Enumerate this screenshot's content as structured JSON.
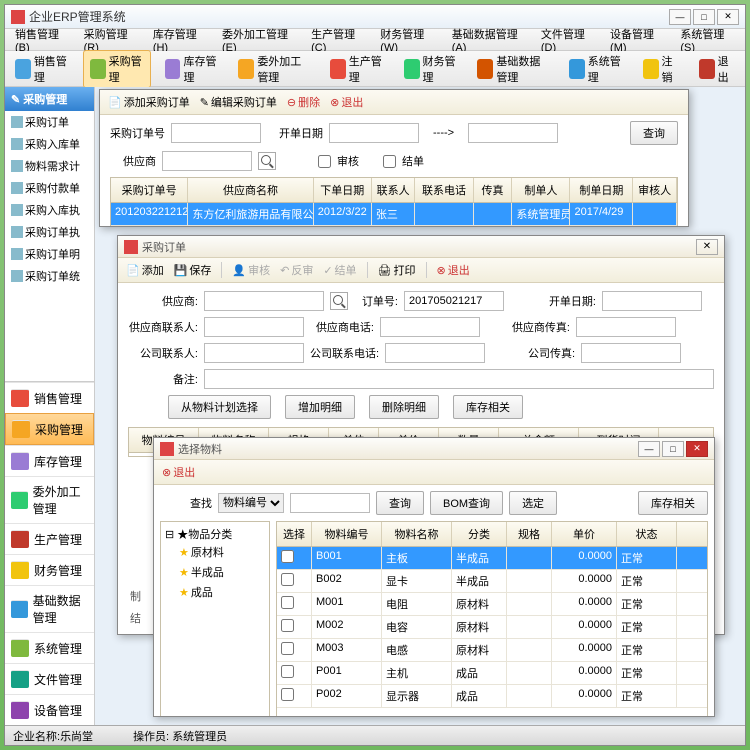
{
  "app_title": "企业ERP管理系统",
  "menubar": [
    "销售管理(B)",
    "采购管理(R)",
    "库存管理(H)",
    "委外加工管理(E)",
    "生产管理(C)",
    "财务管理(W)",
    "基础数据管理(A)",
    "文件管理(D)",
    "设备管理(M)",
    "系统管理(S)"
  ],
  "toolbar": [
    {
      "label": "销售管理",
      "color": "#4aa3df"
    },
    {
      "label": "采购管理",
      "color": "#7fb93e",
      "active": true
    },
    {
      "label": "库存管理",
      "color": "#9a7cd4"
    },
    {
      "label": "委外加工管理",
      "color": "#f5a623"
    },
    {
      "label": "生产管理",
      "color": "#e74c3c"
    },
    {
      "label": "财务管理",
      "color": "#2ecc71"
    },
    {
      "label": "基础数据管理",
      "color": "#d35400"
    },
    {
      "label": "系统管理",
      "color": "#3498db"
    },
    {
      "label": "注销",
      "color": "#f1c40f"
    },
    {
      "label": "退出",
      "color": "#c0392b"
    }
  ],
  "sidebar": {
    "header": "采购管理",
    "items": [
      "采购订单",
      "采购入库单",
      "物料需求计",
      "采购付款单",
      "采购入库执",
      "采购订单执",
      "采购订单明",
      "采购订单统"
    ],
    "bottom": [
      {
        "label": "销售管理",
        "color": "#e74c3c"
      },
      {
        "label": "采购管理",
        "color": "#f5a623",
        "active": true
      },
      {
        "label": "库存管理",
        "color": "#9a7cd4"
      },
      {
        "label": "委外加工管理",
        "color": "#2ecc71"
      },
      {
        "label": "生产管理",
        "color": "#c0392b"
      },
      {
        "label": "财务管理",
        "color": "#f1c40f"
      },
      {
        "label": "基础数据管理",
        "color": "#3498db"
      },
      {
        "label": "系统管理",
        "color": "#7fb93e"
      },
      {
        "label": "文件管理",
        "color": "#16a085"
      },
      {
        "label": "设备管理",
        "color": "#8e44ad"
      }
    ]
  },
  "statusbar": {
    "company_label": "企业名称:",
    "company": "乐尚堂",
    "operator_label": "操作员:",
    "operator": "系统管理员"
  },
  "dialog1": {
    "toolbar": {
      "add": "添加采购订单",
      "edit": "编辑采购订单",
      "del": "删除",
      "exit": "退出"
    },
    "labels": {
      "order_no": "采购订单号",
      "date": "开单日期",
      "arrow": "---->",
      "query": "查询",
      "supplier": "供应商",
      "audit": "审核",
      "close": "结单"
    },
    "grid_headers": [
      "采购订单号",
      "供应商名称",
      "下单日期",
      "联系人",
      "联系电话",
      "传真",
      "制单人",
      "制单日期",
      "审核人"
    ],
    "grid_row": [
      "201203221212",
      "东方亿利旅游用品有限公司",
      "2012/3/22",
      "张三",
      "",
      "",
      "系统管理员",
      "2017/4/29",
      ""
    ]
  },
  "dialog2": {
    "title": "采购订单",
    "toolbar": {
      "add": "添加",
      "save": "保存",
      "audit": "审核",
      "unaudit": "反审",
      "close": "结单",
      "print": "打印",
      "exit": "退出"
    },
    "labels": {
      "supplier": "供应商:",
      "order_no": "订单号:",
      "order_no_val": "201705021217",
      "date": "开单日期:",
      "supplier_contact": "供应商联系人:",
      "supplier_phone": "供应商电话:",
      "supplier_fax": "供应商传真:",
      "company_contact": "公司联系人:",
      "company_phone": "公司联系电话:",
      "company_fax": "公司传真:",
      "remark": "备注:"
    },
    "buttons": {
      "from_plan": "从物料计划选择",
      "add_detail": "增加明细",
      "del_detail": "删除明细",
      "stock": "库存相关"
    },
    "grid_headers": [
      "物料编号",
      "物料名称",
      "规格",
      "单位",
      "单价",
      "数量",
      "总金额",
      "到货时间"
    ],
    "bottom": {
      "maker": "制",
      "closer": "结"
    }
  },
  "dialog3": {
    "title": "选择物料",
    "exit": "退出",
    "search": {
      "label": "查找",
      "field": "物料编号",
      "query": "查询",
      "bom": "BOM查询",
      "select": "选定",
      "stock": "库存相关"
    },
    "tree": {
      "root": "物品分类",
      "children": [
        "原材料",
        "半成品",
        "成品"
      ]
    },
    "grid_headers": [
      "选择",
      "物料编号",
      "物料名称",
      "分类",
      "规格",
      "单价",
      "状态"
    ],
    "rows": [
      {
        "id": "B001",
        "name": "主板",
        "cat": "半成品",
        "price": "0.0000",
        "status": "正常",
        "sel": true
      },
      {
        "id": "B002",
        "name": "显卡",
        "cat": "半成品",
        "price": "0.0000",
        "status": "正常"
      },
      {
        "id": "M001",
        "name": "电阻",
        "cat": "原材料",
        "price": "0.0000",
        "status": "正常"
      },
      {
        "id": "M002",
        "name": "电容",
        "cat": "原材料",
        "price": "0.0000",
        "status": "正常"
      },
      {
        "id": "M003",
        "name": "电感",
        "cat": "原材料",
        "price": "0.0000",
        "status": "正常"
      },
      {
        "id": "P001",
        "name": "主机",
        "cat": "成品",
        "price": "0.0000",
        "status": "正常"
      },
      {
        "id": "P002",
        "name": "显示器",
        "cat": "成品",
        "price": "0.0000",
        "status": "正常"
      }
    ]
  }
}
